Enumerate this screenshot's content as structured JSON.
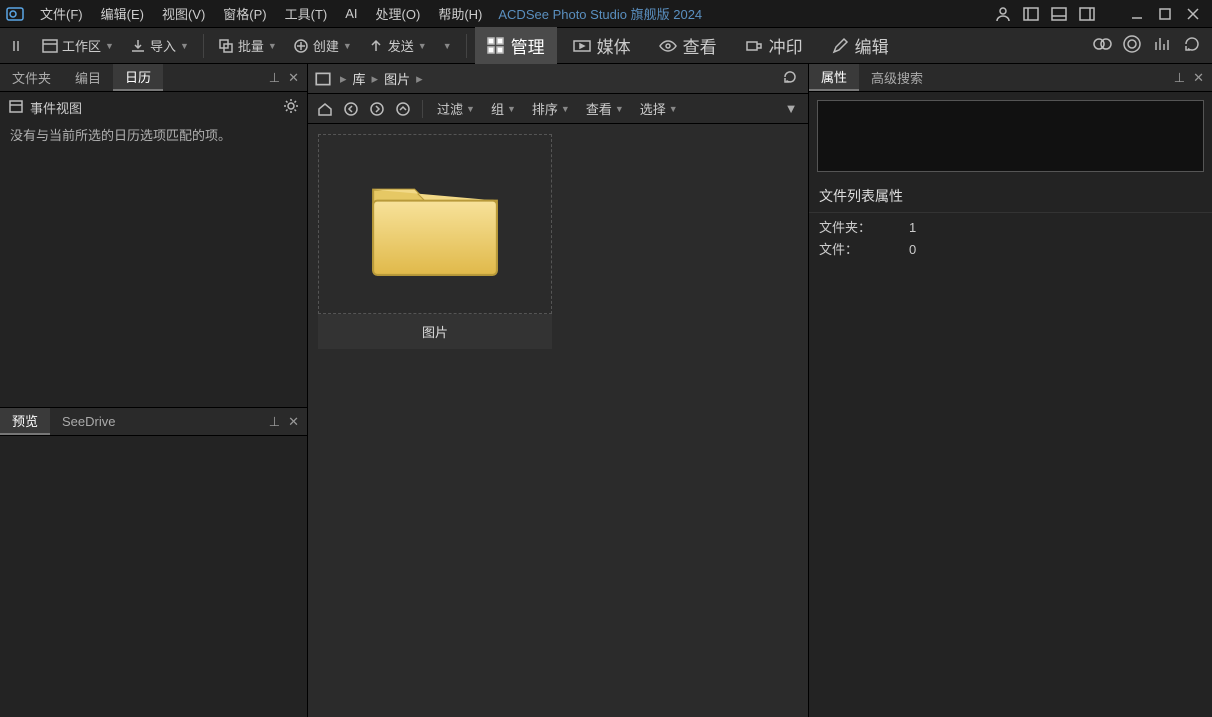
{
  "app": {
    "title": "ACDSee Photo Studio 旗舰版 2024"
  },
  "menubar": {
    "items": [
      "文件(F)",
      "编辑(E)",
      "视图(V)",
      "窗格(P)",
      "工具(T)",
      "AI",
      "处理(O)",
      "帮助(H)"
    ]
  },
  "toolbar": {
    "workspace": "工作区",
    "import": "导入",
    "batch": "批量",
    "create": "创建",
    "send": "发送",
    "modes": {
      "manage": "管理",
      "media": "媒体",
      "view": "查看",
      "develop": "冲印",
      "edit": "编辑"
    }
  },
  "left": {
    "tabs": [
      "文件夹",
      "编目",
      "日历"
    ],
    "active_tab": 2,
    "event_view_label": "事件视图",
    "empty_msg": "没有与当前所选的日历选项匹配的项。",
    "lower_tabs": [
      "预览",
      "SeeDrive"
    ],
    "lower_active": 0
  },
  "center": {
    "breadcrumbs": [
      "库",
      "图片"
    ],
    "filters": {
      "filter": "过滤",
      "group": "组",
      "sort": "排序",
      "view": "查看",
      "select": "选择"
    },
    "item": {
      "label": "图片"
    }
  },
  "right": {
    "tabs": [
      "属性",
      "高级搜索"
    ],
    "active_tab": 0,
    "section_title": "文件列表属性",
    "rows": [
      {
        "k": "文件夹：",
        "v": "1"
      },
      {
        "k": "文件：",
        "v": "0"
      }
    ]
  }
}
